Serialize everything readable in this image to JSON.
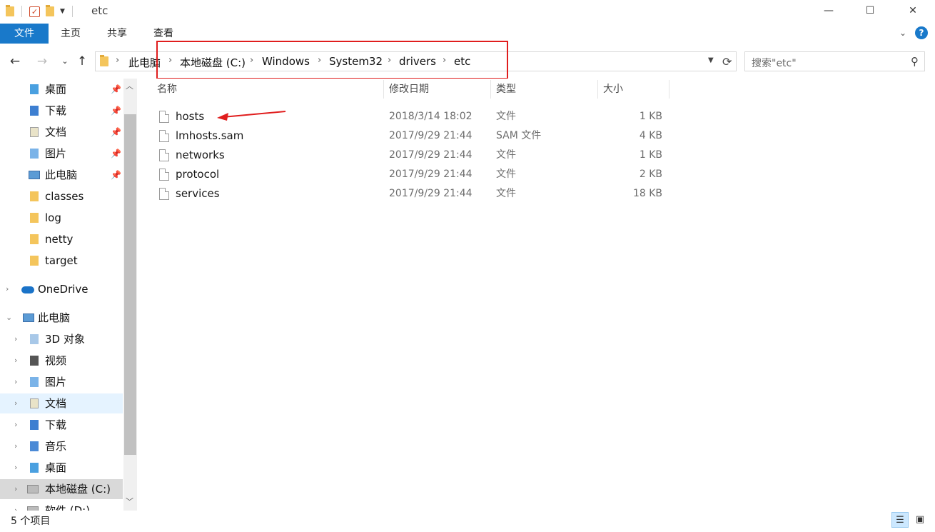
{
  "window": {
    "title": "etc",
    "minimize_glyph": "—",
    "maximize_glyph": "☐",
    "close_glyph": "✕"
  },
  "ribbon": {
    "tabs": [
      "文件",
      "主页",
      "共享",
      "查看"
    ]
  },
  "address": {
    "breadcrumbs": [
      "此电脑",
      "本地磁盘 (C:)",
      "Windows",
      "System32",
      "drivers",
      "etc"
    ],
    "separator": "›"
  },
  "search": {
    "placeholder": "搜索\"etc\""
  },
  "nav": {
    "quick_access": [
      {
        "label": "桌面",
        "icon": "desktop-folder-icon",
        "pinned": true
      },
      {
        "label": "下载",
        "icon": "downloads-folder-icon",
        "pinned": true
      },
      {
        "label": "文档",
        "icon": "documents-folder-icon",
        "pinned": true
      },
      {
        "label": "图片",
        "icon": "pictures-folder-icon",
        "pinned": true
      },
      {
        "label": "此电脑",
        "icon": "computer-icon",
        "pinned": true
      },
      {
        "label": "classes",
        "icon": "folder-icon",
        "pinned": false
      },
      {
        "label": "log",
        "icon": "folder-icon",
        "pinned": false
      },
      {
        "label": "netty",
        "icon": "folder-icon",
        "pinned": false
      },
      {
        "label": "target",
        "icon": "folder-icon",
        "pinned": false
      }
    ],
    "onedrive": "OneDrive",
    "this_pc": "此电脑",
    "pc_children": [
      {
        "label": "3D 对象",
        "icon": "3d-objects-icon"
      },
      {
        "label": "视频",
        "icon": "videos-icon"
      },
      {
        "label": "图片",
        "icon": "pictures-folder-icon"
      },
      {
        "label": "文档",
        "icon": "documents-folder-icon"
      },
      {
        "label": "下载",
        "icon": "downloads-folder-icon"
      },
      {
        "label": "音乐",
        "icon": "music-icon"
      },
      {
        "label": "桌面",
        "icon": "desktop-folder-icon"
      },
      {
        "label": "本地磁盘 (C:)",
        "icon": "drive-icon"
      },
      {
        "label": "软件 (D:)",
        "icon": "drive-icon"
      }
    ]
  },
  "columns": {
    "name": "名称",
    "modified": "修改日期",
    "type": "类型",
    "size": "大小"
  },
  "files": [
    {
      "name": "hosts",
      "modified": "2018/3/14 18:02",
      "type": "文件",
      "size": "1 KB"
    },
    {
      "name": "lmhosts.sam",
      "modified": "2017/9/29 21:44",
      "type": "SAM 文件",
      "size": "4 KB"
    },
    {
      "name": "networks",
      "modified": "2017/9/29 21:44",
      "type": "文件",
      "size": "1 KB"
    },
    {
      "name": "protocol",
      "modified": "2017/9/29 21:44",
      "type": "文件",
      "size": "2 KB"
    },
    {
      "name": "services",
      "modified": "2017/9/29 21:44",
      "type": "文件",
      "size": "18 KB"
    }
  ],
  "status": {
    "item_count": "5 个项目"
  },
  "colors": {
    "accent": "#1979ca",
    "annotation": "#e01d1d"
  }
}
